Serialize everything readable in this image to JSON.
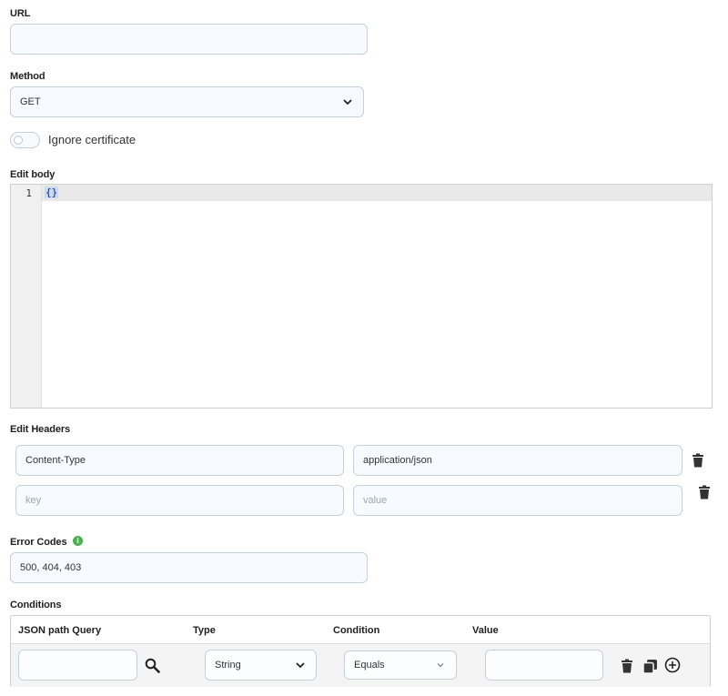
{
  "url": {
    "label": "URL",
    "value": "",
    "placeholder": ""
  },
  "method": {
    "label": "Method",
    "selected": "GET"
  },
  "ignore_certificate": {
    "label": "Ignore certificate",
    "enabled": false
  },
  "body": {
    "label": "Edit body",
    "line_number": "1",
    "code": "{}"
  },
  "headers": {
    "label": "Edit Headers",
    "rows": [
      {
        "key": "Content-Type",
        "value": "application/json"
      },
      {
        "key": "",
        "value": ""
      }
    ],
    "key_placeholder": "key",
    "value_placeholder": "value"
  },
  "error_codes": {
    "label": "Error Codes",
    "value": "500, 404, 403",
    "info_icon": "info-icon"
  },
  "conditions": {
    "label": "Conditions",
    "columns": [
      "JSON path Query",
      "Type",
      "Condition",
      "Value"
    ],
    "row": {
      "json_path": "",
      "type": "String",
      "condition": "Equals",
      "value": ""
    }
  },
  "colors": {
    "input_border": "#c3d1de",
    "input_bg": "#f7fbff",
    "info_green": "#4caf50"
  }
}
